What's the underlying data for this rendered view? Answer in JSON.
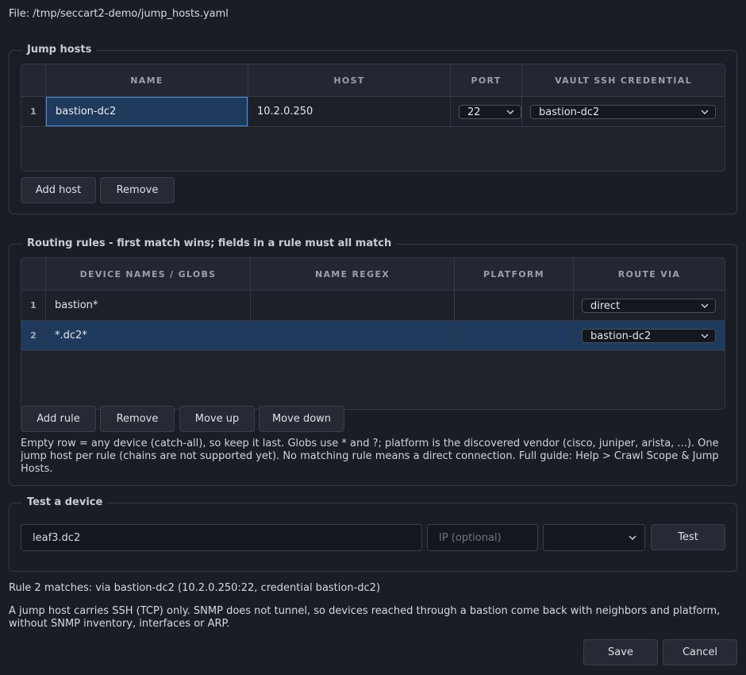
{
  "file_label": "File: /tmp/seccart2-demo/jump_hosts.yaml",
  "jump_hosts": {
    "title": "Jump hosts",
    "columns": [
      "NAME",
      "HOST",
      "PORT",
      "VAULT SSH CREDENTIAL"
    ],
    "rows": [
      {
        "num": "1",
        "name": "bastion-dc2",
        "host": "10.2.0.250",
        "port": "22",
        "credential": "bastion-dc2"
      }
    ],
    "add_label": "Add host",
    "remove_label": "Remove"
  },
  "routing": {
    "title": "Routing rules - first match wins; fields in a rule must all match",
    "columns": [
      "DEVICE NAMES / GLOBS",
      "NAME REGEX",
      "PLATFORM",
      "ROUTE VIA"
    ],
    "rows": [
      {
        "num": "1",
        "globs": "bastion*",
        "regex": "",
        "platform": "",
        "route": "direct"
      },
      {
        "num": "2",
        "globs": "*.dc2*",
        "regex": "",
        "platform": "",
        "route": "bastion-dc2"
      }
    ],
    "selected_row": 2,
    "add_label": "Add rule",
    "remove_label": "Remove",
    "move_up_label": "Move up",
    "move_down_label": "Move down",
    "help": "Empty row = any device (catch-all), so keep it last. Globs use * and ?; platform is the discovered vendor (cisco, juniper, arista, ...). One jump host per rule (chains are not supported yet). No matching rule means a direct connection. Full guide: Help > Crawl Scope & Jump Hosts."
  },
  "test": {
    "title": "Test a device",
    "device_value": "leaf3.dc2",
    "ip_placeholder": "IP (optional)",
    "platform_value": "",
    "test_label": "Test"
  },
  "result": "Rule 2 matches: via bastion-dc2 (10.2.0.250:22, credential bastion-dc2)",
  "note": "A jump host carries SSH (TCP) only. SNMP does not tunnel, so devices reached through a bastion come back with neighbors and platform, without SNMP inventory, interfaces or ARP.",
  "footer": {
    "save_label": "Save",
    "cancel_label": "Cancel"
  },
  "colors": {
    "background": "#1a1d25",
    "selection": "#1f3a5c",
    "focus_border": "#4a8fe0"
  }
}
